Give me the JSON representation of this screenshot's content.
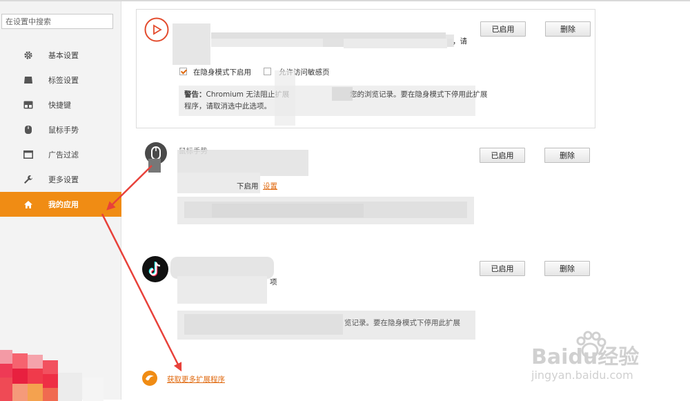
{
  "search": {
    "placeholder": "在设置中搜索"
  },
  "sidebar": {
    "items": [
      {
        "label": "基本设置",
        "icon": "gear-icon"
      },
      {
        "label": "标签设置",
        "icon": "tab-icon"
      },
      {
        "label": "快捷键",
        "icon": "keyboard-icon"
      },
      {
        "label": "鼠标手势",
        "icon": "mouse-icon"
      },
      {
        "label": "广告过滤",
        "icon": "window-icon"
      },
      {
        "label": "更多设置",
        "icon": "wrench-icon"
      },
      {
        "label": "我的应用",
        "icon": "home-icon",
        "active": true
      }
    ],
    "active_color": "#f08c14"
  },
  "extensions": [
    {
      "enabled_label": "已启用",
      "delete_label": "删除",
      "desc_tail": "，请",
      "incognito_label": "在隐身模式下启用",
      "incognito_checked": true,
      "file_access_label": "允许访问敏感页",
      "file_access_checked": false,
      "warning_bold": "警告：",
      "warning_line1": "Chromium 无法阻止扩展",
      "warning_line1b": "您的浏览记录。要在隐身模式下停用此扩展",
      "warning_line2": "程序，请取消选中此选项。"
    },
    {
      "name_partial": "鼠标手势",
      "enabled_label": "已启用",
      "delete_label": "删除",
      "incognito_partial": "下启用",
      "settings_link": "设置"
    },
    {
      "enabled_label": "已启用",
      "delete_label": "删除",
      "desc_partial": "项",
      "warning_partial": "览记录。要在隐身模式下停用此扩展"
    }
  ],
  "get_more_link": "获取更多扩展程序",
  "watermark": {
    "brand": "Baidu经验",
    "url": "jingyan.baidu.com"
  },
  "colors": {
    "accent": "#f08c14",
    "arrow": "#e8413a",
    "link": "#e06a10"
  }
}
